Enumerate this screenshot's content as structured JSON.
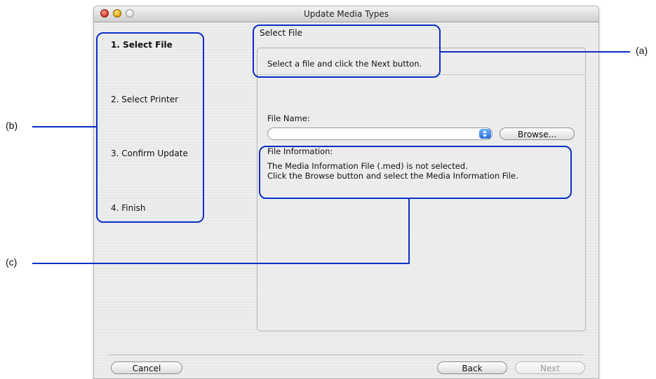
{
  "window": {
    "title": "Update Media Types"
  },
  "steps": [
    {
      "label": "1. Select File",
      "active": true
    },
    {
      "label": "2. Select Printer",
      "active": false
    },
    {
      "label": "3. Confirm Update",
      "active": false
    },
    {
      "label": "4. Finish",
      "active": false
    }
  ],
  "main": {
    "section_title": "Select File",
    "instruction": "Select a file and click the Next button.",
    "file_name_label": "File Name:",
    "file_name_value": "",
    "browse_label": "Browse...",
    "file_info_label": "File Information:",
    "file_info_line1": "The Media Information File (.med) is not selected.",
    "file_info_line2": "Click the Browse button and select the Media Information File."
  },
  "footer": {
    "cancel_label": "Cancel",
    "back_label": "Back",
    "next_label": "Next"
  },
  "callouts": {
    "a": "(a)",
    "b": "(b)",
    "c": "(c)"
  },
  "colors": {
    "highlight": "#0a2fc6"
  }
}
